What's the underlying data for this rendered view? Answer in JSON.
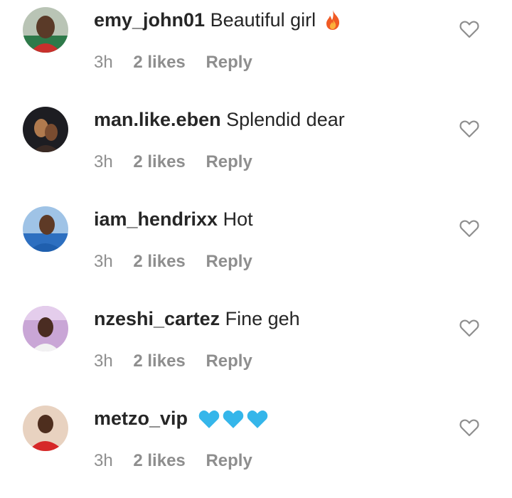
{
  "comments": [
    {
      "username": "emy_john01",
      "text": "Beautiful girl",
      "emoji": "fire-emoji",
      "time": "3h",
      "likes": "2 likes",
      "reply": "Reply"
    },
    {
      "username": "man.like.eben",
      "text": "Splendid dear",
      "emoji": "",
      "time": "3h",
      "likes": "2 likes",
      "reply": "Reply"
    },
    {
      "username": "iam_hendrixx",
      "text": "Hot",
      "emoji": "",
      "time": "3h",
      "likes": "2 likes",
      "reply": "Reply"
    },
    {
      "username": "nzeshi_cartez",
      "text": "Fine geh",
      "emoji": "",
      "time": "3h",
      "likes": "2 likes",
      "reply": "Reply"
    },
    {
      "username": "metzo_vip",
      "text": "",
      "emoji": "blue-heart-emoji x3",
      "time": "3h",
      "likes": "2 likes",
      "reply": "Reply"
    }
  ],
  "colors": {
    "text": "#262626",
    "meta": "#8e8e8e",
    "heart_outline": "#8e8e8e",
    "blue_heart": "#35b6ea",
    "fire": "#f05a24"
  }
}
